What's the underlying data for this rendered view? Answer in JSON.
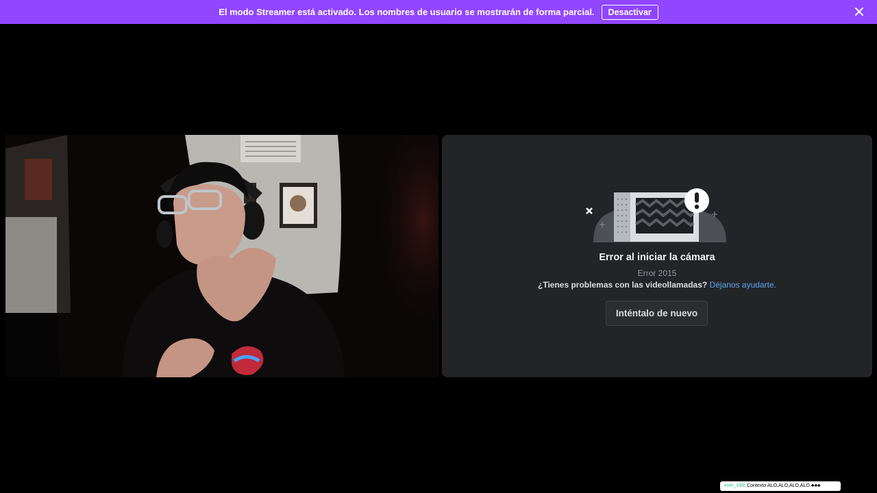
{
  "banner": {
    "message": "El modo Streamer está activado. Los nombres de usuario se mostrarán de forma parcial.",
    "deactivate_label": "Desactivar",
    "background_color": "#9146ff"
  },
  "webcam": {
    "description_icon": "webcam-feed"
  },
  "camera_error": {
    "title": "Error al iniciar la cámara",
    "code": "Error 2015",
    "help_text": "¿Tienes problemas con las videollamadas?",
    "help_link": "Déjanos ayudarte.",
    "retry_label": "Inténtalo de nuevo",
    "link_color": "#5ba7ec"
  },
  "chat_overlay": {
    "username": "ever_189",
    "message": ": Contexto:ALO,ALO,ALO,ALO ♣♣♣"
  }
}
